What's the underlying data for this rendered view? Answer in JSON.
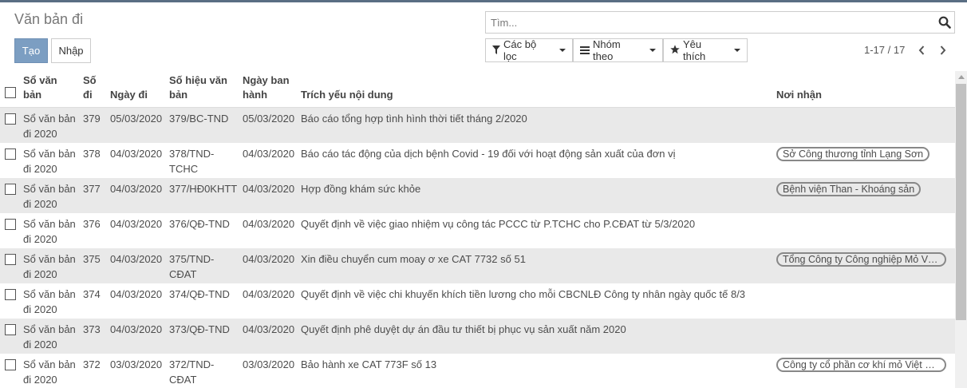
{
  "page": {
    "title": "Văn bản đi"
  },
  "toolbar": {
    "create_label": "Tạo",
    "import_label": "Nhập"
  },
  "search": {
    "placeholder": "Tìm..."
  },
  "filters": {
    "filter_label": "Các bộ lọc",
    "group_label": "Nhóm theo",
    "favorite_label": "Yêu thích"
  },
  "pager": {
    "value": "1-17 / 17"
  },
  "table": {
    "headers": {
      "book": "Sổ văn bản",
      "number": "Số đi",
      "date_out": "Ngày đi",
      "code": "Số hiệu văn bản",
      "date_issued": "Ngày ban hành",
      "summary": "Trích yếu nội dung",
      "recipient": "Nơi nhận"
    },
    "rows": [
      {
        "book": "Sổ văn bản đi 2020",
        "number": "379",
        "date_out": "05/03/2020",
        "code": "379/BC-TND",
        "date_issued": "05/03/2020",
        "summary": "Báo cáo tổng hợp tình hình thời tiết tháng 2/2020",
        "recipient": ""
      },
      {
        "book": "Sổ văn bản đi 2020",
        "number": "378",
        "date_out": "04/03/2020",
        "code": "378/TND-TCHC",
        "date_issued": "04/03/2020",
        "summary": "Báo cáo tác động của dịch bệnh Covid - 19 đối với hoạt động sản xuất của đơn vị",
        "recipient": "Sở Công thương tỉnh Lạng Sơn"
      },
      {
        "book": "Sổ văn bản đi 2020",
        "number": "377",
        "date_out": "04/03/2020",
        "code": "377/HĐ0KHTT",
        "date_issued": "04/03/2020",
        "summary": "Hợp đồng khám sức khỏe",
        "recipient": "Bệnh viện Than - Khoáng sản"
      },
      {
        "book": "Sổ văn bản đi 2020",
        "number": "376",
        "date_out": "04/03/2020",
        "code": "376/QĐ-TND",
        "date_issued": "04/03/2020",
        "summary": "Quyết định về việc giao nhiệm vụ công tác PCCC từ P.TCHC cho P.CĐAT từ 5/3/2020",
        "recipient": ""
      },
      {
        "book": "Sổ văn bản đi 2020",
        "number": "375",
        "date_out": "04/03/2020",
        "code": "375/TND-CĐAT",
        "date_issued": "04/03/2020",
        "summary": "Xin điều chuyển cum moay ơ xe CAT 7732 số 51",
        "recipient": "Tổng Công ty Công nghiệp Mỏ Việt Bắc"
      },
      {
        "book": "Sổ văn bản đi 2020",
        "number": "374",
        "date_out": "04/03/2020",
        "code": "374/QĐ-TND",
        "date_issued": "04/03/2020",
        "summary": "Quyết định về việc chi khuyến khích tiền lương cho mỗi CBCNLĐ Công ty nhân ngày quốc tế 8/3",
        "recipient": ""
      },
      {
        "book": "Sổ văn bản đi 2020",
        "number": "373",
        "date_out": "04/03/2020",
        "code": "373/QĐ-TND",
        "date_issued": "04/03/2020",
        "summary": "Quyết định phê  duyệt dự án đầu tư thiết bị phục vụ sản xuất năm 2020",
        "recipient": ""
      },
      {
        "book": "Sổ văn bản đi 2020",
        "number": "372",
        "date_out": "03/03/2020",
        "code": "372/TND-CĐAT",
        "date_issued": "03/03/2020",
        "summary": "Bảo hành  xe CAT 773F số 13",
        "recipient": "Công ty cổ phần cơ khí mỏ Việt Bắc"
      }
    ]
  },
  "colors": {
    "primary": "#7c9ec2",
    "row_stripe": "#e9e9e9",
    "topbar": "#5a6e83"
  }
}
